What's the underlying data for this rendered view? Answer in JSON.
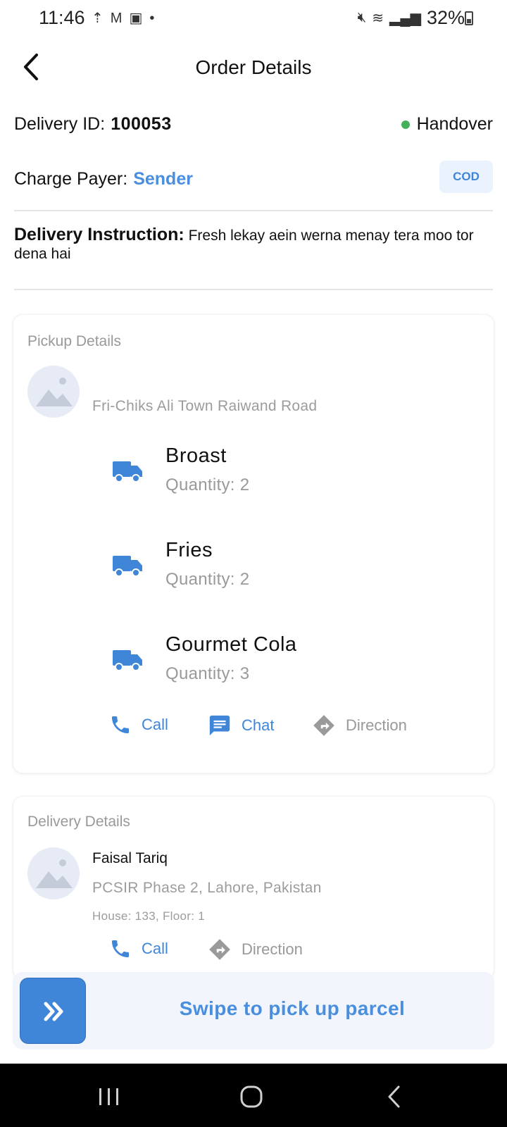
{
  "status_bar": {
    "time": "11:46",
    "battery": "32%",
    "left_icons": [
      "uploading-icon",
      "gmail-icon",
      "gallery-icon",
      "dot-icon"
    ],
    "right_icons": [
      "mute-icon",
      "wifi-icon",
      "signal-icon",
      "battery-icon"
    ]
  },
  "header": {
    "title": "Order Details"
  },
  "order": {
    "delivery_id_label": "Delivery ID:",
    "delivery_id": "100053",
    "status": "Handover",
    "status_color": "#43b05c",
    "charge_payer_label": "Charge Payer:",
    "charge_payer": "Sender",
    "payment_badge": "COD",
    "instruction_label": "Delivery Instruction:",
    "instruction": "Fresh lekay aein werna menay tera moo tor dena hai"
  },
  "pickup": {
    "title": "Pickup Details",
    "address": "Fri-Chiks Ali Town Raiwand Road",
    "items": [
      {
        "name": "Broast",
        "quantity": "Quantity: 2"
      },
      {
        "name": "Fries",
        "quantity": "Quantity: 2"
      },
      {
        "name": "Gourmet Cola",
        "quantity": "Quantity: 3"
      }
    ],
    "actions": {
      "call": "Call",
      "chat": "Chat",
      "direction": "Direction"
    }
  },
  "delivery": {
    "title": "Delivery Details",
    "name": "Faisal Tariq",
    "address": "PCSIR Phase 2, Lahore, Pakistan",
    "house": "House: 133, Floor: 1",
    "actions": {
      "call": "Call",
      "direction": "Direction"
    }
  },
  "swipe": {
    "label": "Swipe to pick up parcel"
  },
  "colors": {
    "accent": "#3f86d8",
    "muted": "#9c9c9c"
  }
}
